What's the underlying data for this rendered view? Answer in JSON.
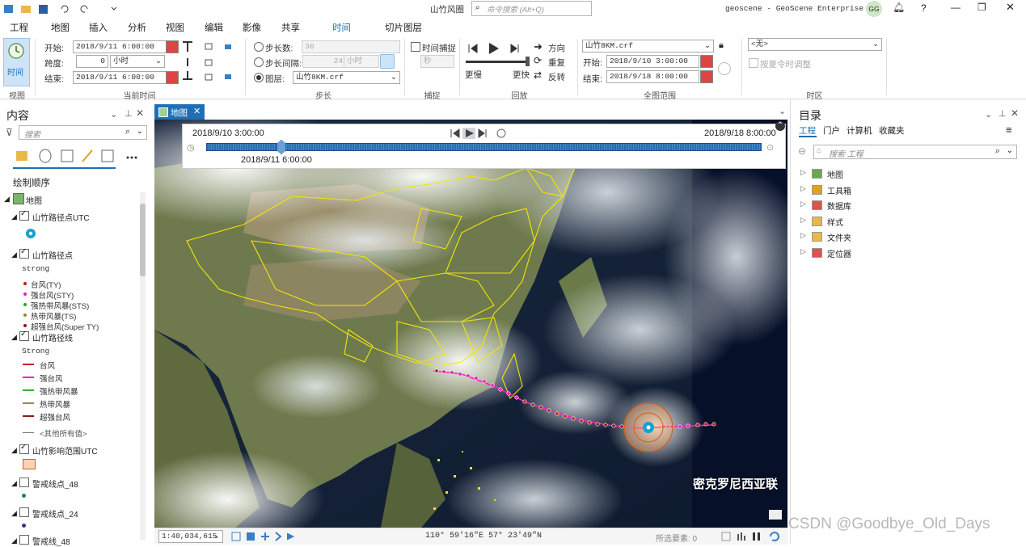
{
  "titlebar": {
    "doc_title": "山竹风圈",
    "command_search_placeholder": "命令搜索 (Alt+Q)",
    "app_title": "geoscene - GeoScene Enterprise 4.1",
    "user_initials": "GG",
    "help_label": "?"
  },
  "tabs": [
    "工程",
    "地图",
    "插入",
    "分析",
    "视图",
    "编辑",
    "影像",
    "共享",
    "时间",
    "切片图层"
  ],
  "ribbon": {
    "view_group": {
      "button_label": "时间",
      "group_label": "视图"
    },
    "current_time": {
      "start_label": "开始:",
      "start_value": "2018/9/11 6:00:00",
      "span_label": "跨度:",
      "span_value": "0",
      "span_unit": "小时",
      "end_label": "结束:",
      "end_value": "2018/9/11 6:00:00",
      "group_label": "当前时间"
    },
    "step": {
      "step_count_label": "步长数:",
      "step_count_value": "30",
      "step_interval_label": "步长间隔:",
      "step_interval_value": "24",
      "step_interval_unit": "小时",
      "layer_label": "图层:",
      "layer_value": "山竹8KM.crf",
      "group_label": "步长"
    },
    "snap": {
      "time_snap_label": "时间捕捉",
      "unit": "秒",
      "group_label": "捕捉"
    },
    "playback": {
      "direction_label": "方向",
      "repeat_label": "重复",
      "reverse_label": "反转",
      "slower_label": "更慢",
      "faster_label": "更快",
      "group_label": "回放"
    },
    "full_extent": {
      "layer_value": "山竹8KM.crf",
      "start_label": "开始:",
      "start_value": "2018/9/10 3:00:00",
      "end_label": "结束:",
      "end_value": "2018/9/18 8:00:00",
      "group_label": "全图范围"
    },
    "timezone": {
      "value": "<无>",
      "dst_label": "按夏令时调整",
      "group_label": "时区"
    }
  },
  "contents": {
    "title": "内容",
    "search_placeholder": "搜索",
    "draw_order_label": "绘制顺序",
    "map_label": "地图",
    "layers": [
      {
        "name": "山竹路径点UTC"
      },
      {
        "name": "山竹路径点",
        "field": "strong",
        "classes": [
          {
            "label": "台风(TY)",
            "color": "#b22222"
          },
          {
            "label": "强台风(STY)",
            "color": "#e020c0"
          },
          {
            "label": "强热带风暴(STS)",
            "color": "#2aa52a"
          },
          {
            "label": "热带风暴(TS)",
            "color": "#8a8a4a"
          },
          {
            "label": "超强台风(Super TY)",
            "color": "#8b1a1a"
          }
        ]
      },
      {
        "name": "山竹路径线",
        "field": "Strong",
        "classes": [
          {
            "label": "台风",
            "color": "#c0202a"
          },
          {
            "label": "强台风",
            "color": "#ff1fbf"
          },
          {
            "label": "强热带风暴",
            "color": "#2fb52f"
          },
          {
            "label": "热带风暴",
            "color": "#9a8a50"
          },
          {
            "label": "超强台风",
            "color": "#8b1a1a"
          }
        ],
        "other_label": "<其他所有值>"
      },
      {
        "name": "山竹影响范围UTC"
      },
      {
        "name": "警戒线点_48"
      },
      {
        "name": "警戒线点_24"
      },
      {
        "name": "警戒线_48"
      }
    ]
  },
  "map": {
    "tab_label": "地图",
    "slider_start": "2018/9/10 3:00:00",
    "slider_end": "2018/9/18 8:00:00",
    "slider_current": "2018/9/11 6:00:00",
    "place_label": "密克罗尼西亚联"
  },
  "statusbar": {
    "scale": "1:40,034,615",
    "coords": "110° 59′16″E 57° 23′49″N",
    "selected": "所选要素: 0"
  },
  "catalog": {
    "title": "目录",
    "tabs": [
      "工程",
      "门户",
      "计算机",
      "收藏夹"
    ],
    "search_placeholder": "搜索 工程",
    "items": [
      "地图",
      "工具箱",
      "数据库",
      "样式",
      "文件夹",
      "定位器"
    ]
  },
  "watermark": "CSDN @Goodbye_Old_Days"
}
